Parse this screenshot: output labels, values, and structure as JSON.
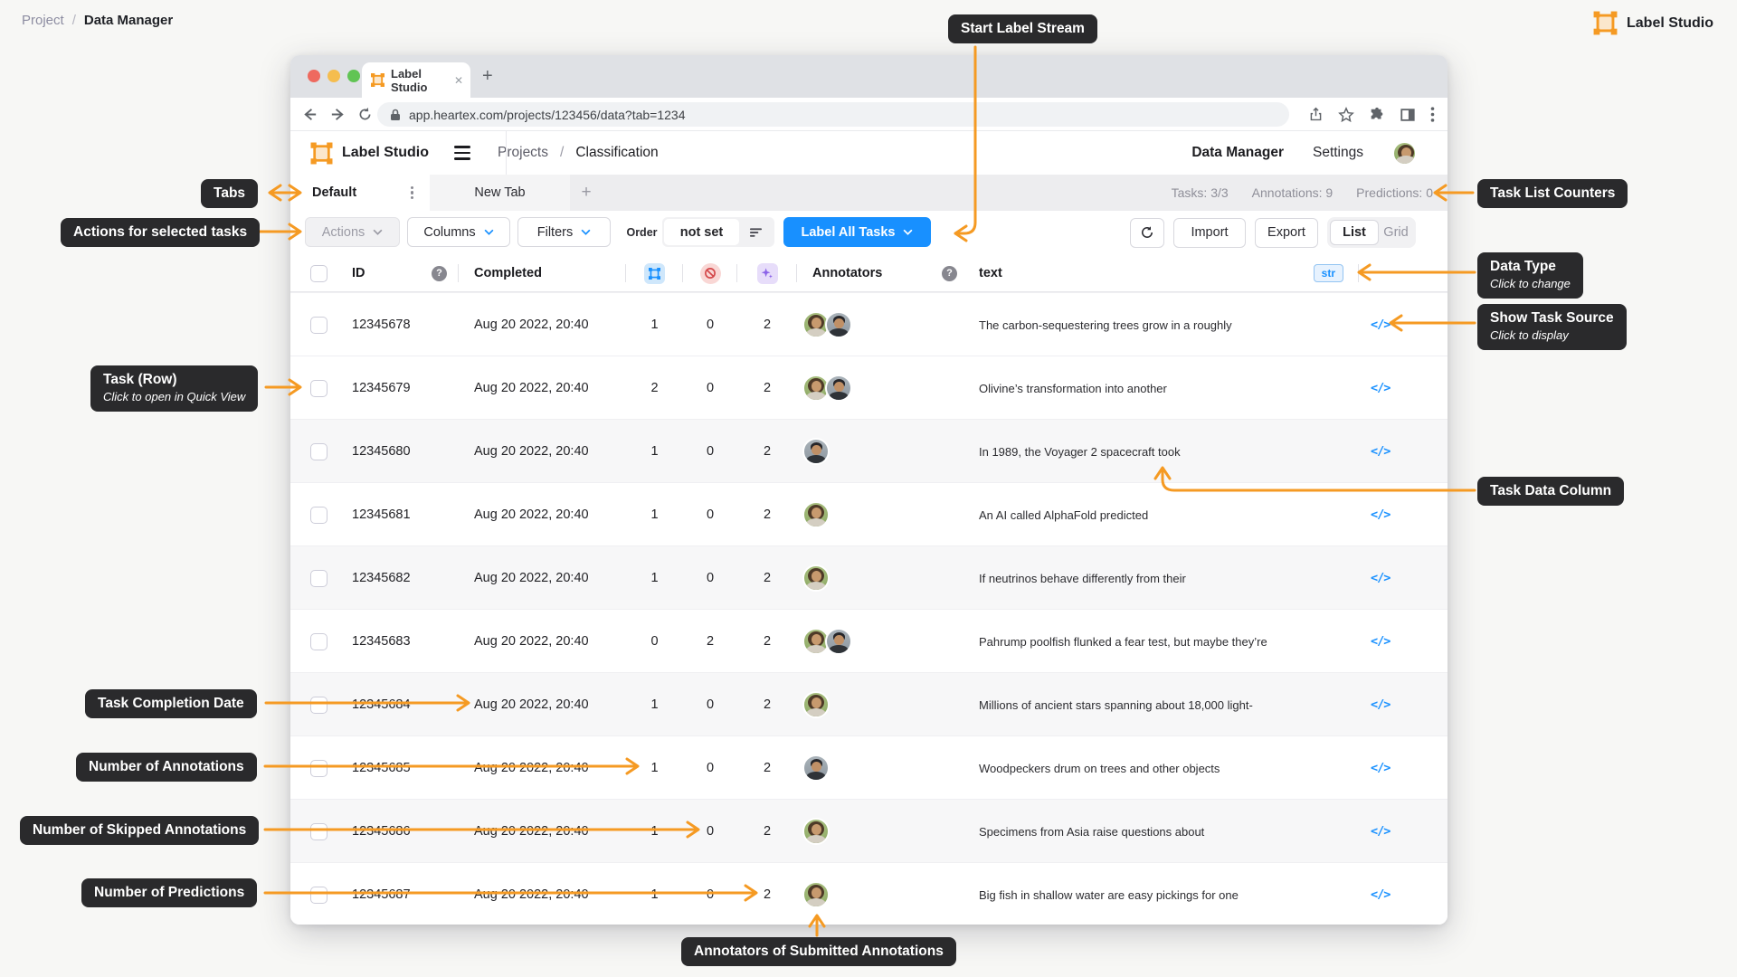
{
  "page": {
    "breadcrumb": {
      "project": "Project",
      "separator": "/",
      "current": "Data Manager"
    },
    "brand": "Label Studio"
  },
  "browser": {
    "tab_title": "Label Studio",
    "url": "app.heartex.com/projects/123456/data?tab=1234"
  },
  "app": {
    "brand": "Label Studio",
    "nav": {
      "projects": "Projects",
      "separator": "/",
      "classification": "Classification"
    },
    "menu": {
      "data_manager": "Data Manager",
      "settings": "Settings"
    }
  },
  "tabs": {
    "default_label": "Default",
    "new_tab_label": "New Tab",
    "add_label": "+",
    "counters": {
      "tasks": "Tasks: 3/3",
      "annotations": "Annotations: 9",
      "predictions": "Predictions: 0"
    }
  },
  "toolbar": {
    "actions": "Actions",
    "columns": "Columns",
    "filters": "Filters",
    "order_label": "Order",
    "order_value": "not set",
    "label_all_tasks": "Label All Tasks",
    "import": "Import",
    "export": "Export",
    "view_list": "List",
    "view_grid": "Grid"
  },
  "table": {
    "headers": {
      "id": "ID",
      "completed": "Completed",
      "annotators": "Annotators",
      "text": "text",
      "type_badge": "str"
    },
    "source_glyph": "</>",
    "rows": [
      {
        "id": "12345678",
        "completed": "Aug 20 2022, 20:40",
        "annotations": 1,
        "skipped": 0,
        "predictions": 2,
        "annotators": [
          "woman",
          "man"
        ],
        "text": "The carbon-sequestering trees grow in a roughly"
      },
      {
        "id": "12345679",
        "completed": "Aug 20 2022, 20:40",
        "annotations": 2,
        "skipped": 0,
        "predictions": 2,
        "annotators": [
          "woman",
          "man"
        ],
        "text": "Olivine’s transformation into another"
      },
      {
        "id": "12345680",
        "completed": "Aug 20 2022, 20:40",
        "annotations": 1,
        "skipped": 0,
        "predictions": 2,
        "annotators": [
          "man"
        ],
        "text": "In 1989, the Voyager 2 spacecraft took"
      },
      {
        "id": "12345681",
        "completed": "Aug 20 2022, 20:40",
        "annotations": 1,
        "skipped": 0,
        "predictions": 2,
        "annotators": [
          "woman"
        ],
        "text": "An AI called AlphaFold predicted"
      },
      {
        "id": "12345682",
        "completed": "Aug 20 2022, 20:40",
        "annotations": 1,
        "skipped": 0,
        "predictions": 2,
        "annotators": [
          "woman"
        ],
        "text": "If neutrinos behave differently from their"
      },
      {
        "id": "12345683",
        "completed": "Aug 20 2022, 20:40",
        "annotations": 0,
        "skipped": 2,
        "predictions": 2,
        "annotators": [
          "woman",
          "man"
        ],
        "text": "Pahrump poolfish flunked a fear test, but maybe they’re"
      },
      {
        "id": "12345684",
        "completed": "Aug 20 2022, 20:40",
        "annotations": 1,
        "skipped": 0,
        "predictions": 2,
        "annotators": [
          "woman"
        ],
        "text": "Millions of ancient stars spanning about 18,000 light-"
      },
      {
        "id": "12345685",
        "completed": "Aug 20 2022, 20:40",
        "annotations": 1,
        "skipped": 0,
        "predictions": 2,
        "annotators": [
          "man"
        ],
        "text": "Woodpeckers drum on trees and other objects"
      },
      {
        "id": "12345686",
        "completed": "Aug 20 2022, 20:40",
        "annotations": 1,
        "skipped": 0,
        "predictions": 2,
        "annotators": [
          "woman"
        ],
        "text": "Specimens from Asia raise questions about"
      },
      {
        "id": "12345687",
        "completed": "Aug 20 2022, 20:40",
        "annotations": 1,
        "skipped": 0,
        "predictions": 2,
        "annotators": [
          "woman"
        ],
        "text": "Big fish in shallow water are easy pickings for one"
      }
    ]
  },
  "callouts": {
    "start_label_stream": {
      "title": "Start Label Stream"
    },
    "tabs": {
      "title": "Tabs"
    },
    "actions": {
      "title": "Actions for selected tasks"
    },
    "task_list_counters": {
      "title": "Task List Counters"
    },
    "data_type": {
      "title": "Data Type",
      "subtitle": "Click to change"
    },
    "show_task_source": {
      "title": "Show Task Source",
      "subtitle": "Click to display"
    },
    "task_row": {
      "title": "Task (Row)",
      "subtitle": "Click to open in Quick View"
    },
    "task_data_column": {
      "title": "Task Data Column"
    },
    "task_completion_date": {
      "title": "Task Completion Date"
    },
    "number_of_annotations": {
      "title": "Number of Annotations"
    },
    "number_of_skipped": {
      "title": "Number of Skipped Annotations"
    },
    "number_of_predictions": {
      "title": "Number of Predictions"
    },
    "annotators_submitted": {
      "title": "Annotators of Submitted Annotations"
    }
  },
  "colors": {
    "accent_orange": "#F59A23",
    "accent_blue": "#1890FF",
    "callout_bg": "#2A2A2C",
    "skipped_red": "#DD4C4C",
    "predictions_purple": "#8B63E8"
  }
}
